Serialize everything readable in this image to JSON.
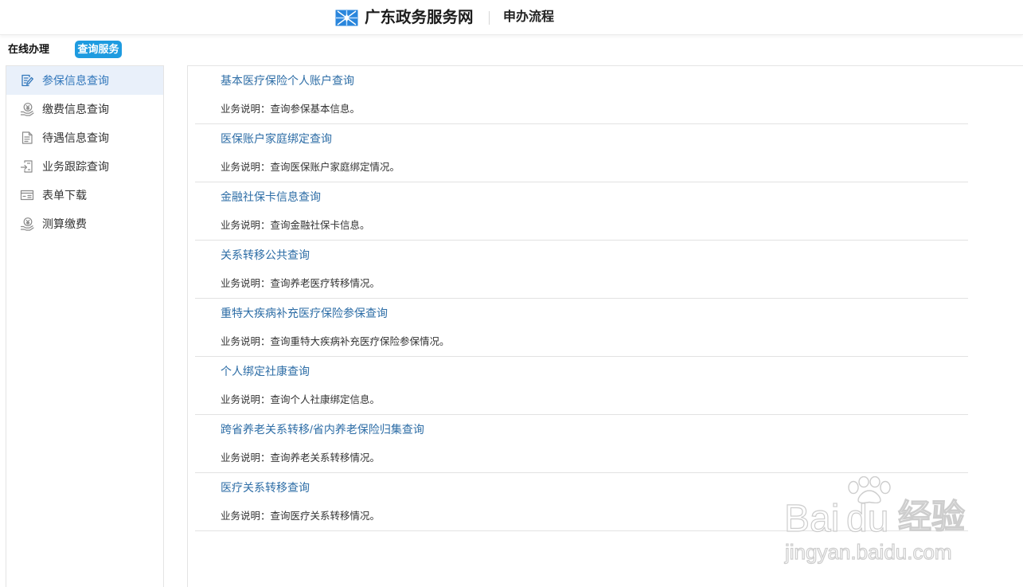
{
  "header": {
    "logo_icon": "snowflake-logo-icon",
    "site_title": "广东政务服务网",
    "section_title": "申办流程"
  },
  "subnav": {
    "online_label": "在线办理",
    "query_label": "查询服务"
  },
  "sidebar": {
    "items": [
      {
        "label": "参保信息查询",
        "icon": "edit-document-icon",
        "active": true
      },
      {
        "label": "缴费信息查询",
        "icon": "payment-icon",
        "active": false
      },
      {
        "label": "待遇信息查询",
        "icon": "list-document-icon",
        "active": false
      },
      {
        "label": "业务跟踪查询",
        "icon": "tracking-icon",
        "active": false
      },
      {
        "label": "表单下载",
        "icon": "form-icon",
        "active": false
      },
      {
        "label": "测算缴费",
        "icon": "payment-calculator-icon",
        "active": false
      }
    ]
  },
  "services": [
    {
      "title": "基本医疗保险个人账户查询",
      "description": "业务说明：查询参保基本信息。"
    },
    {
      "title": "医保账户家庭绑定查询",
      "description": "业务说明：查询医保账户家庭绑定情况。"
    },
    {
      "title": "金融社保卡信息查询",
      "description": "业务说明：查询金融社保卡信息。"
    },
    {
      "title": "关系转移公共查询",
      "description": "业务说明：查询养老医疗转移情况。"
    },
    {
      "title": "重特大疾病补充医疗保险参保查询",
      "description": "业务说明：查询重特大疾病补充医疗保险参保情况。"
    },
    {
      "title": "个人绑定社康查询",
      "description": "业务说明：查询个人社康绑定信息。"
    },
    {
      "title": "跨省养老关系转移/省内养老保险归集查询",
      "description": "业务说明：查询养老关系转移情况。"
    },
    {
      "title": "医疗关系转移查询",
      "description": "业务说明：查询医疗关系转移情况。"
    }
  ],
  "watermark": {
    "brand_latin_1": "Bai",
    "brand_latin_2": "du",
    "brand_cn": "经验",
    "url": "jingyan.baidu.com",
    "icon": "paw-icon"
  },
  "colors": {
    "accent": "#1e9be0",
    "link": "#2d6da6",
    "active_background": "#e9f0fa",
    "active_text": "#3277bb"
  }
}
